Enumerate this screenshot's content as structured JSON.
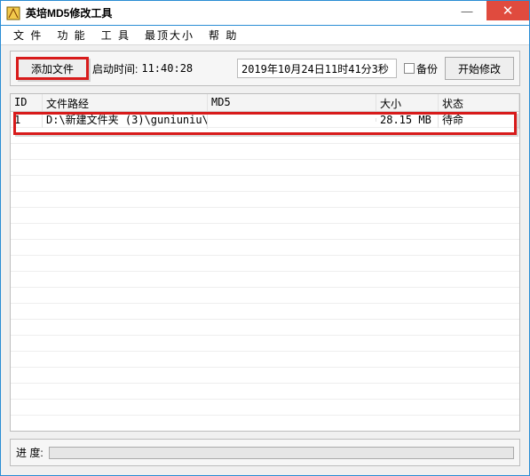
{
  "window": {
    "title": "英培MD5修改工具"
  },
  "menu": {
    "file": "文 件",
    "function": "功 能",
    "tool": "工 具",
    "topmost": "最顶大小",
    "help": "帮 助"
  },
  "toolbar": {
    "add_file": "添加文件",
    "start_time_label": "启动时间:",
    "start_time_value": "11:40:28",
    "timestamp": "2019年10月24日11时41分3秒",
    "backup_label": "备份",
    "start_modify": "开始修改"
  },
  "table": {
    "headers": {
      "id": "ID",
      "path": "文件路经",
      "md5": "MD5",
      "size": "大小",
      "status": "状态"
    },
    "rows": [
      {
        "id": "1",
        "path": "D:\\新建文件夹 (3)\\guniuniu\\b...",
        "md5": "",
        "size": "28.15 MB",
        "status": "待命"
      }
    ]
  },
  "bottom": {
    "progress_label": "进 度:"
  }
}
